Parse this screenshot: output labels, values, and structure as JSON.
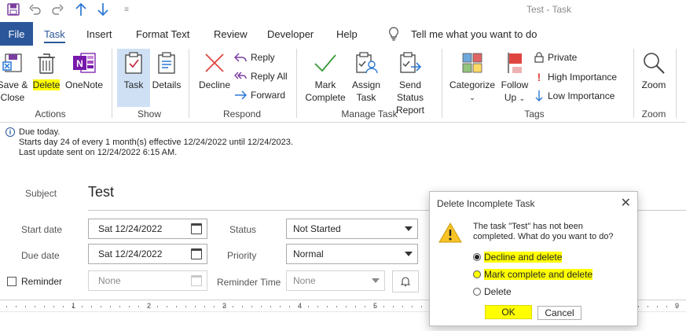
{
  "window": {
    "title": "Test  -  Task"
  },
  "qat": {
    "icons": [
      "save-icon",
      "undo-icon",
      "redo-icon",
      "up-arrow-icon",
      "down-arrow-icon",
      "customize-qat-icon"
    ]
  },
  "tabs": {
    "file": "File",
    "items": [
      "Task",
      "Insert",
      "Format Text",
      "Review",
      "Developer",
      "Help"
    ],
    "active": "Task",
    "tell_me": "Tell me what you want to do"
  },
  "ribbon": {
    "actions": {
      "label": "Actions",
      "save_close_1": "Save &",
      "save_close_2": "Close",
      "delete": "Delete",
      "onenote": "OneNote"
    },
    "show": {
      "label": "Show",
      "task": "Task",
      "details": "Details"
    },
    "respond": {
      "label": "Respond",
      "decline": "Decline",
      "reply": "Reply",
      "reply_all": "Reply All",
      "forward": "Forward"
    },
    "manage": {
      "label": "Manage Task",
      "mark_1": "Mark",
      "mark_2": "Complete",
      "assign_1": "Assign",
      "assign_2": "Task",
      "send_1": "Send Status",
      "send_2": "Report"
    },
    "tags": {
      "label": "Tags",
      "categorize": "Categorize",
      "follow_1": "Follow",
      "follow_2": "Up",
      "private": "Private",
      "high": "High Importance",
      "low": "Low Importance"
    },
    "zoom": {
      "label": "Zoom",
      "zoom": "Zoom"
    },
    "colors": {
      "accent": "#2b579a",
      "highlight": "#ffff00"
    }
  },
  "info": {
    "line1": "Due today.",
    "line2": "Starts day 24 of every 1 month(s) effective 12/24/2022 until 12/24/2023.",
    "line3": "Last update sent on 12/24/2022 6:15 AM."
  },
  "form": {
    "subject_label": "Subject",
    "subject_value": "Test",
    "start_label": "Start date",
    "start_value": "Sat 12/24/2022",
    "due_label": "Due date",
    "due_value": "Sat 12/24/2022",
    "reminder_label": "Reminder",
    "reminder_date": "None",
    "status_label": "Status",
    "status_value": "Not Started",
    "priority_label": "Priority",
    "priority_value": "Normal",
    "reminder_time_label": "Reminder Time",
    "reminder_time_value": "None"
  },
  "ruler": {
    "numbers": [
      "1",
      "2",
      "3",
      "4",
      "5",
      "9"
    ]
  },
  "dialog": {
    "title": "Delete Incomplete Task",
    "message_1": "The task \"Test\" has not been",
    "message_2": "completed. What do you want to do?",
    "options": [
      "Decline and delete",
      "Mark complete and delete",
      "Delete"
    ],
    "selected": "Decline and delete",
    "ok": "OK",
    "cancel": "Cancel"
  }
}
